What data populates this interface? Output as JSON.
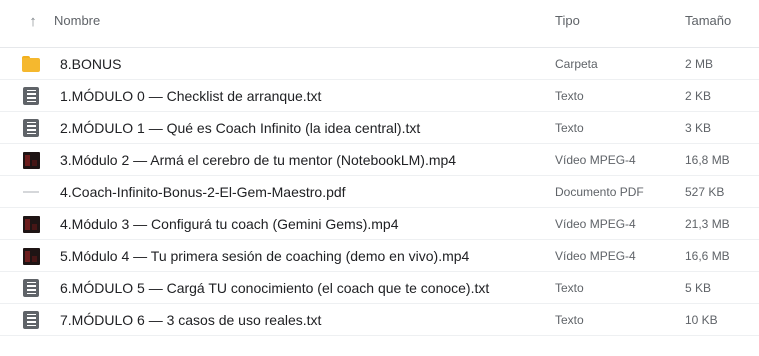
{
  "header": {
    "name_label": "Nombre",
    "type_label": "Tipo",
    "size_label": "Tamaño",
    "sort_icon": "arrow-up-icon"
  },
  "colors": {
    "folder": "#f5b82e",
    "text_doc": "#5f6368",
    "video_thumb": "#1e1414"
  },
  "files": [
    {
      "icon": "folder-icon",
      "name": "8.BONUS",
      "type": "Carpeta",
      "size": "2 MB"
    },
    {
      "icon": "text-file-icon",
      "name": "1.MÓDULO 0 — Checklist de arranque.txt",
      "type": "Texto",
      "size": "2 KB"
    },
    {
      "icon": "text-file-icon",
      "name": "2.MÓDULO 1 — Qué es Coach Infinito (la idea central).txt",
      "type": "Texto",
      "size": "3 KB"
    },
    {
      "icon": "video-thumbnail-icon",
      "name": "3.Módulo 2 — Armá el cerebro de tu mentor (NotebookLM).mp4",
      "type": "Vídeo MPEG-4",
      "size": "16,8 MB"
    },
    {
      "icon": "pdf-thumbnail-icon",
      "name": "4.Coach-Infinito-Bonus-2-El-Gem-Maestro.pdf",
      "type": "Documento PDF",
      "size": "527 KB"
    },
    {
      "icon": "video-thumbnail-icon",
      "name": "4.Módulo 3 — Configurá tu coach (Gemini Gems).mp4",
      "type": "Vídeo MPEG-4",
      "size": "21,3 MB"
    },
    {
      "icon": "video-thumbnail-icon",
      "name": "5.Módulo 4 — Tu primera sesión de coaching (demo en vivo).mp4",
      "type": "Vídeo MPEG-4",
      "size": "16,6 MB"
    },
    {
      "icon": "text-file-icon",
      "name": "6.MÓDULO 5 — Cargá TU conocimiento (el coach que te conoce).txt",
      "type": "Texto",
      "size": "5 KB"
    },
    {
      "icon": "text-file-icon",
      "name": "7.MÓDULO 6 — 3 casos de uso reales.txt",
      "type": "Texto",
      "size": "10 KB"
    }
  ]
}
